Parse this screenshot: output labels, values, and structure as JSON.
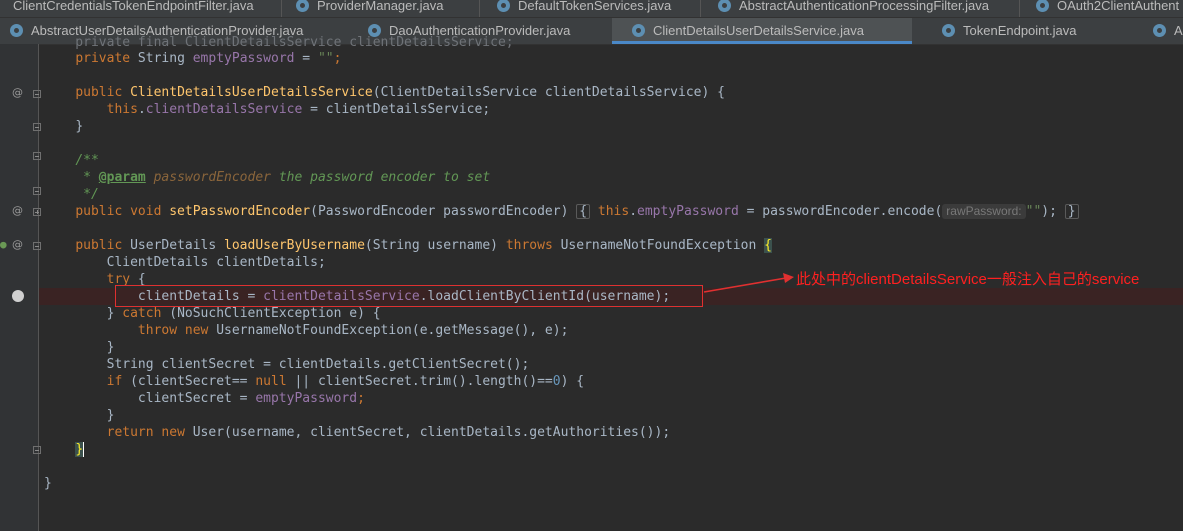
{
  "tabs_row1": [
    {
      "label": "ClientCredentialsTokenEndpointFilter.java"
    },
    {
      "label": "ProviderManager.java"
    },
    {
      "label": "DefaultTokenServices.java"
    },
    {
      "label": "AbstractAuthenticationProcessingFilter.java"
    },
    {
      "label": "OAuth2ClientAuthent"
    }
  ],
  "tabs_row2": [
    {
      "label": "AbstractUserDetailsAuthenticationProvider.java"
    },
    {
      "label": "DaoAuthenticationProvider.java"
    },
    {
      "label": "ClientDetailsUserDetailsService.java",
      "active": true
    },
    {
      "label": "TokenEndpoint.java"
    },
    {
      "label": "Al"
    }
  ],
  "code": {
    "l0": "    private final ClientDetailsService clientDetailsService;",
    "l1_kw": "private",
    "l1_type": " String ",
    "l1_fld": "emptyPassword",
    "l1_eq": " = ",
    "l1_str": "\"\"",
    "l1_end": ";",
    "l3_kw": "public ",
    "l3_fn": "ClientDetailsUserDetailsService",
    "l3_rest": "(ClientDetailsService clientDetailsService) {",
    "l4_kw": "this",
    "l4_dot": ".",
    "l4_fld": "clientDetailsService",
    "l4_rest": " = clientDetailsService;",
    "l5": "}",
    "l7": "/**",
    "l8_a": " * ",
    "l8_tag": "@param",
    "l8_sp": " ",
    "l8_pm": "passwordEncoder",
    "l8_rest": " the password encoder to set",
    "l9": " */",
    "l10_kw": "public void ",
    "l10_fn": "setPasswordEncoder",
    "l10_a": "(PasswordEncoder passwordEncoder) ",
    "l10_b": "{",
    "l10_sp": " ",
    "l10_kw2": "this",
    "l10_c": ".",
    "l10_fld": "emptyPassword",
    "l10_d": " = passwordEncoder.encode(",
    "l10_hint": "rawPassword:",
    "l10_str": "\"\"",
    "l10_e": ");",
    "l10_f": "}",
    "l12_kw": "public ",
    "l12_type": "UserDetails ",
    "l12_fn": "loadUserByUsername",
    "l12_a": "(String username) ",
    "l12_kw2": "throws",
    "l12_b": " UsernameNotFoundException ",
    "l12_br": "{",
    "l13": "ClientDetails clientDetails;",
    "l14_kw": "try",
    "l14_rest": " {",
    "l15_a": "clientDetails = ",
    "l15_fld": "clientDetailsService",
    "l15_rest": ".loadClientByClientId(username);",
    "l16_a": "} ",
    "l16_kw": "catch",
    "l16_rest": " (NoSuchClientException e) {",
    "l17_kw": "throw new",
    "l17_rest": " UsernameNotFoundException(e.getMessage(), e);",
    "l18": "}",
    "l19": "String clientSecret = clientDetails.getClientSecret();",
    "l20_kw": "if",
    "l20_a": " (clientSecret== ",
    "l20_kw2": "null",
    "l20_b": " || clientSecret.trim().length()==",
    "l20_num": "0",
    "l20_c": ") {",
    "l21_a": "clientSecret = ",
    "l21_fld": "emptyPassword",
    "l21_end": ";",
    "l22": "}",
    "l23_kw": "return new",
    "l23_rest": " User(username, clientSecret, clientDetails.getAuthorities());",
    "l24": "}",
    "l26": "}"
  },
  "annotation": "此处中的clientDetailsService一般注入自己的service",
  "colors": {
    "annotation": "#ff2020",
    "active_tab_underline": "#4a88c7"
  }
}
